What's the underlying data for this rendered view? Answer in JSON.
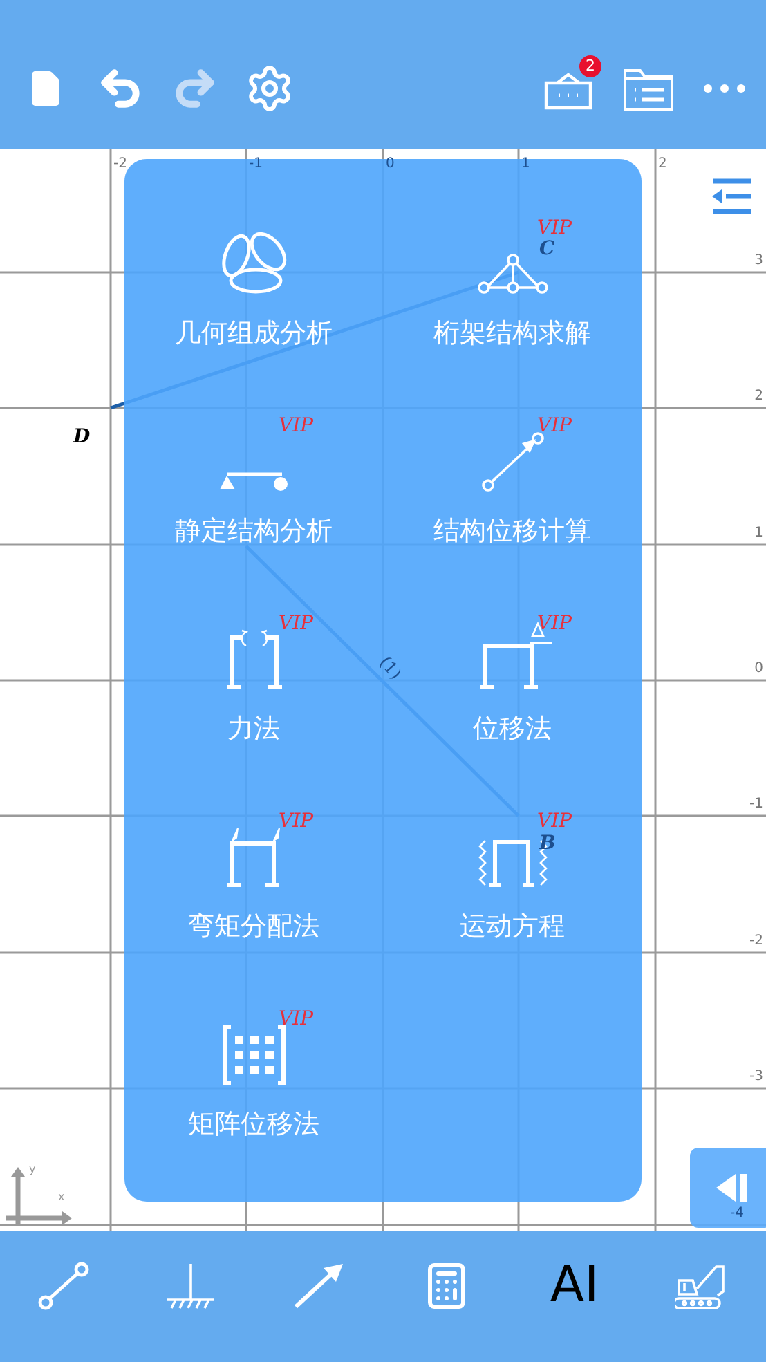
{
  "top_bar": {
    "left_buttons": [
      {
        "kind": "file",
        "disabled": false
      },
      {
        "kind": "undo",
        "disabled": false
      },
      {
        "kind": "redo",
        "disabled": true
      },
      {
        "kind": "settings",
        "disabled": false
      }
    ],
    "right_buttons": [
      {
        "kind": "inbox",
        "badge": "2"
      },
      {
        "kind": "folder-list"
      },
      {
        "kind": "more"
      }
    ]
  },
  "canvas": {
    "x_ticks": [
      "-2",
      "-1",
      "0",
      "1",
      "2"
    ],
    "y_ticks": [
      "3",
      "2",
      "1",
      "0",
      "-1",
      "-2",
      "-3",
      "-4"
    ],
    "points": [
      {
        "label": "D"
      },
      {
        "label": "C"
      },
      {
        "label": "B"
      }
    ],
    "member_label": "(1)",
    "axis_labels": {
      "x": "x",
      "y": "y"
    }
  },
  "menu": {
    "items": [
      {
        "kind": "rings",
        "label": "几何组成分析"
      },
      {
        "kind": "truss",
        "label": "桁架结构求解",
        "badge": "VIP"
      },
      {
        "kind": "beam",
        "label": "静定结构分析",
        "badge": "VIP"
      },
      {
        "kind": "displacement",
        "label": "结构位移计算",
        "badge": "VIP"
      },
      {
        "kind": "force-frame",
        "label": "力法",
        "badge": "VIP"
      },
      {
        "kind": "delta-frame",
        "label": "位移法",
        "badge": "VIP"
      },
      {
        "kind": "moment-frame",
        "label": "弯矩分配法",
        "badge": "VIP"
      },
      {
        "kind": "spring-frame",
        "label": "运动方程",
        "badge": "VIP"
      },
      {
        "kind": "matrix",
        "label": "矩阵位移法",
        "badge": "VIP"
      }
    ]
  },
  "bottom_bar": {
    "tools": [
      {
        "kind": "member"
      },
      {
        "kind": "support"
      },
      {
        "kind": "load"
      },
      {
        "kind": "calculator"
      },
      {
        "kind": "text",
        "label": "AI"
      },
      {
        "kind": "excavator"
      }
    ]
  }
}
